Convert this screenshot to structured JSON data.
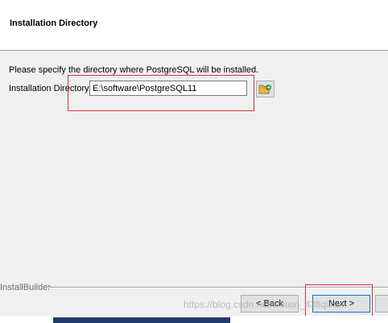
{
  "header": {
    "title": "Installation Directory"
  },
  "main": {
    "instruction": "Please specify the directory where PostgreSQL will be installed.",
    "field_label": "Installation Directory",
    "path_value": "E:\\software\\PostgreSQL11",
    "browse_icon": "folder-browse-icon"
  },
  "footer": {
    "brand": "InstallBuilder",
    "back_label": "< Back",
    "next_label": "Next >"
  },
  "watermark": "https://blog.csdn.net/weixin_43fiqiifan",
  "colors": {
    "highlight": "#d9383d",
    "header_bg": "#ffffff",
    "window_bg": "#f0f0f0"
  }
}
